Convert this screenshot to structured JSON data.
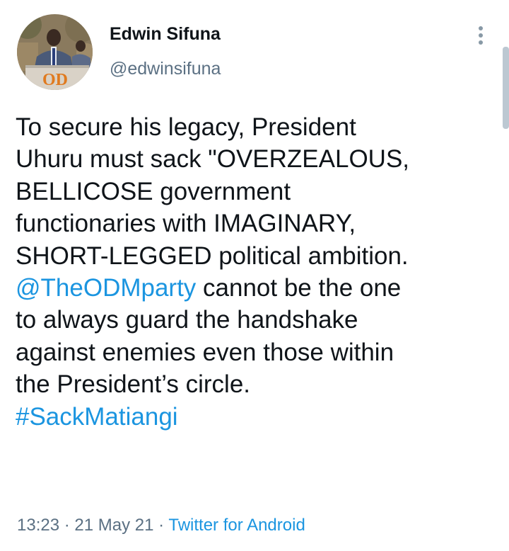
{
  "author": {
    "display_name": "Edwin Sifuna",
    "handle": "@edwinsifuna",
    "avatar_podium_text": "OD"
  },
  "tweet": {
    "line1": "To secure his legacy, President",
    "line2": "Uhuru must sack \"OVERZEALOUS,",
    "line3": "BELLICOSE government",
    "line4": "functionaries with IMAGINARY,",
    "line5": "SHORT-LEGGED political ambition.",
    "mention": "@TheODMparty",
    "line6_rest": " cannot be the one",
    "line7": "to always guard the handshake",
    "line8": "against enemies even those within",
    "line9": "the President’s circle.",
    "hashtag": "#SackMatiangi"
  },
  "meta": {
    "time": "13:23",
    "separator1": " · ",
    "date": "21 May 21",
    "separator2": " · ",
    "source": "Twitter for Android"
  },
  "colors": {
    "link": "#1b95e0",
    "secondary_text": "#5b7083",
    "primary_text": "#0f1419"
  },
  "icons": {
    "more": "more-vertical-icon"
  }
}
